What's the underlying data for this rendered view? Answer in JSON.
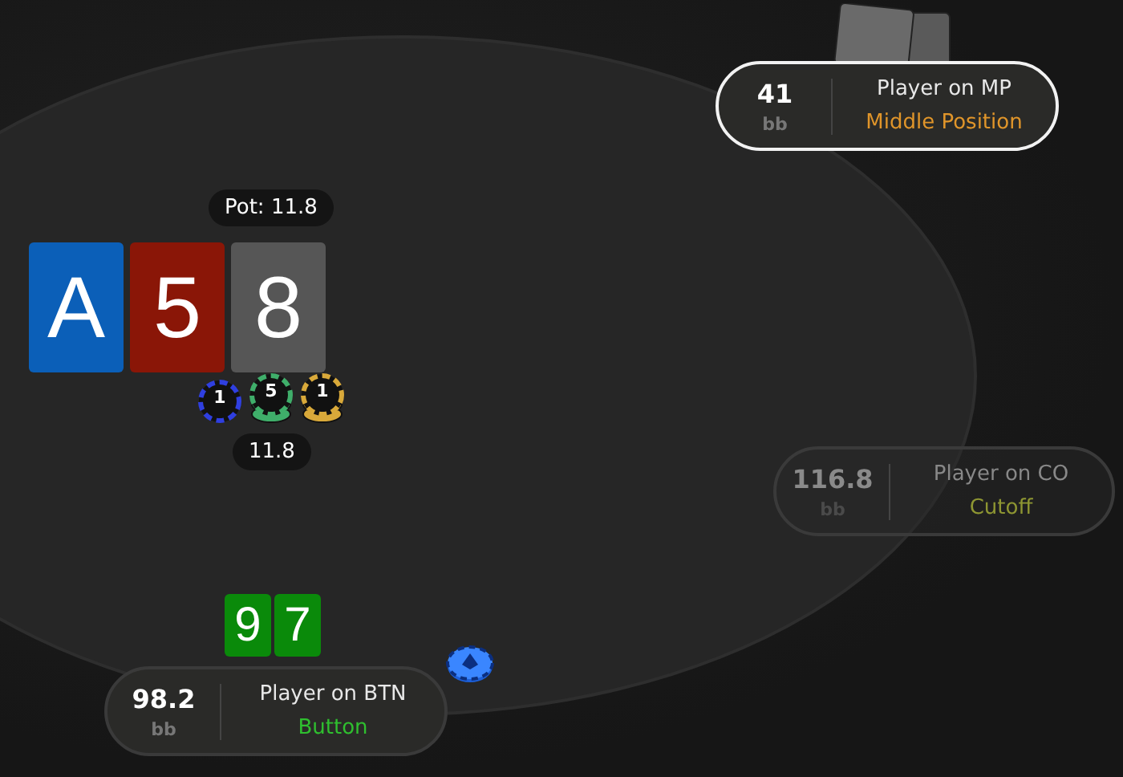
{
  "pot": {
    "label": "Pot: 11.8"
  },
  "board": [
    {
      "rank": "A",
      "color": "#0b5fb8"
    },
    {
      "rank": "5",
      "color": "#8a1607"
    },
    {
      "rank": "8",
      "color": "#565656"
    }
  ],
  "pot_chips": [
    {
      "value": "1",
      "color": "#2f3fe0"
    },
    {
      "value": "5",
      "color": "#3fae6a"
    },
    {
      "value": "1",
      "color": "#d9a93a"
    }
  ],
  "pot_amount": "11.8",
  "seats": [
    {
      "stack": "41",
      "unit": "bb",
      "name": "Player on MP",
      "position": "Middle Position",
      "color": "#e0952a",
      "active": true,
      "folded": false,
      "face_down_cards": true,
      "dealer": false
    },
    {
      "stack": "116.8",
      "unit": "bb",
      "name": "Player on CO",
      "position": "Cutoff",
      "color": "#8e9632",
      "active": false,
      "folded": true,
      "face_down_cards": false,
      "dealer": false
    },
    {
      "stack": "98.2",
      "unit": "bb",
      "name": "Player on BTN",
      "position": "Button",
      "color": "#2fbf2f",
      "active": false,
      "folded": false,
      "face_down_cards": false,
      "dealer": true,
      "hole_cards": [
        {
          "rank": "9",
          "color": "#0a8a0a"
        },
        {
          "rank": "7",
          "color": "#0a8a0a"
        }
      ]
    }
  ]
}
